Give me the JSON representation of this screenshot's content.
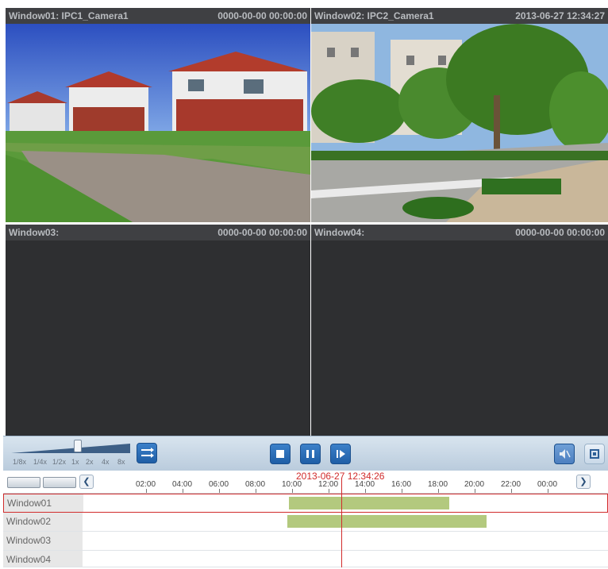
{
  "windows": [
    {
      "title": "Window01: IPC1_Camera1",
      "timestamp": "0000-00-00 00:00:00"
    },
    {
      "title": "Window02: IPC2_Camera1",
      "timestamp": "2013-06-27 12:34:27"
    },
    {
      "title": "Window03:",
      "timestamp": "0000-00-00 00:00:00"
    },
    {
      "title": "Window04:",
      "timestamp": "0000-00-00 00:00:00"
    }
  ],
  "speed_labels": [
    "1/8x",
    "1/4x",
    "1/2x",
    "1x",
    "2x",
    "4x",
    "8x"
  ],
  "timeline": {
    "current_time": "2013-06-27 12:34:26",
    "ticks": [
      "02:00",
      "04:00",
      "06:00",
      "08:00",
      "10:00",
      "12:00",
      "14:00",
      "16:00",
      "18:00",
      "20:00",
      "22:00",
      "00:00"
    ],
    "rows": [
      {
        "label": "Window01"
      },
      {
        "label": "Window02"
      },
      {
        "label": "Window03"
      },
      {
        "label": "Window04"
      }
    ]
  },
  "colors": {
    "accent": "#2fb0c8",
    "record_bar": "#b3c97e",
    "cursor": "#d12b2b"
  },
  "icons": [
    "stop-icon",
    "pause-icon",
    "step-forward-icon",
    "sync-icon",
    "audio-icon",
    "fullscreen-icon",
    "prev-arrow-icon",
    "next-arrow-icon"
  ]
}
